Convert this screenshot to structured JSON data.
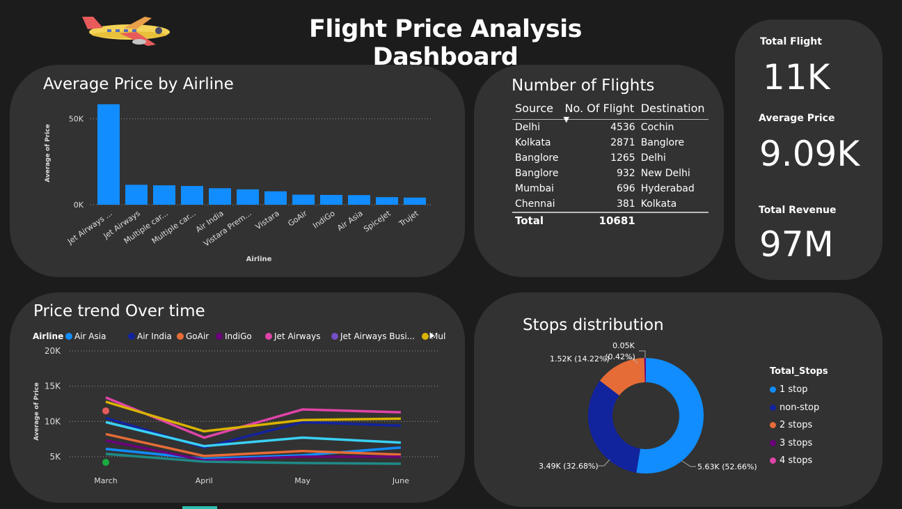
{
  "dashboard": {
    "title": "Flight Price Analysis Dashboard",
    "logo_icon": "airplane-icon"
  },
  "avg_price_card": {
    "title": "Average Price by Airline",
    "ylabel": "Average of Price",
    "xlabel": "Airline",
    "bar_color": "#118dff"
  },
  "flights_card": {
    "title": "Number of Flights",
    "columns": [
      "Source",
      "No. Of Flight",
      "Destination"
    ],
    "sort_indicator": "sort-desc-icon",
    "rows": [
      {
        "source": "Delhi",
        "count": "4536",
        "destination": "Cochin"
      },
      {
        "source": "Kolkata",
        "count": "2871",
        "destination": "Banglore"
      },
      {
        "source": "Banglore",
        "count": "1265",
        "destination": "Delhi"
      },
      {
        "source": "Banglore",
        "count": "932",
        "destination": "New Delhi"
      },
      {
        "source": "Mumbai",
        "count": "696",
        "destination": "Hyderabad"
      },
      {
        "source": "Chennai",
        "count": "381",
        "destination": "Kolkata"
      }
    ],
    "total_label": "Total",
    "total_value": "10681"
  },
  "kpis": {
    "total_flight_label": "Total Flight",
    "total_flight_value": "11K",
    "avg_price_label": "Average Price",
    "avg_price_value": "9.09K",
    "total_revenue_label": "Total Revenue",
    "total_revenue_value": "97M"
  },
  "trend_card": {
    "title": "Price trend Over time",
    "legend_title": "Airline",
    "legend_more_icon": "play-right-icon"
  },
  "stops_card": {
    "title": "Stops distribution",
    "legend_title": "Total_Stops"
  },
  "chart_data": [
    {
      "type": "bar",
      "title": "Average Price by Airline",
      "xlabel": "Airline",
      "ylabel": "Average of Price",
      "categories": [
        "Jet Airways ...",
        "Jet Airways",
        "Multiple car...",
        "Multiple car...",
        "Air India",
        "Vistara Prem...",
        "Vistara",
        "GoAir",
        "IndiGo",
        "Air Asia",
        "SpiceJet",
        "Trujet"
      ],
      "values": [
        58500,
        11600,
        11300,
        10900,
        9600,
        8950,
        7800,
        5850,
        5700,
        5600,
        4400,
        4150
      ],
      "yticks": [
        "0K",
        "50K"
      ],
      "ytick_values": [
        0,
        50000
      ],
      "ylim": [
        0,
        60000
      ],
      "grid": true
    },
    {
      "type": "line",
      "title": "Price trend Over time",
      "ylabel": "Average of Price",
      "categories": [
        "March",
        "April",
        "May",
        "June"
      ],
      "yticks": [
        "5K",
        "10K",
        "15K",
        "20K"
      ],
      "ytick_values": [
        5000,
        10000,
        15000,
        20000
      ],
      "ylim": [
        4000,
        20000
      ],
      "legend": [
        "Air Asia",
        "Air India",
        "GoAir",
        "IndiGo",
        "Jet Airways",
        "Jet Airways Busi...",
        "Multiple carri..."
      ],
      "series": [
        {
          "name": "Air Asia",
          "color": "#118dff",
          "values": [
            6100,
            4700,
            5200,
            6300
          ]
        },
        {
          "name": "Air India",
          "color": "#12239e",
          "values": [
            10500,
            6300,
            9900,
            9400
          ]
        },
        {
          "name": "GoAir",
          "color": "#e66c37",
          "values": [
            8200,
            5100,
            5800,
            5300
          ]
        },
        {
          "name": "IndiGo",
          "color": "#6b007b",
          "values": [
            7300,
            4500,
            5000,
            5000
          ]
        },
        {
          "name": "Jet Airways",
          "color": "#e044a7",
          "values": [
            13400,
            7700,
            11700,
            11300
          ]
        },
        {
          "name": "Multiple carri...",
          "color": "#d9b300",
          "values": [
            12800,
            8600,
            10200,
            10400
          ]
        },
        {
          "name": "",
          "color": "#3ad1f5",
          "values": [
            9900,
            6500,
            7700,
            7000
          ]
        },
        {
          "name": "",
          "color": "#1f8a87",
          "values": [
            5400,
            4300,
            4100,
            4000
          ]
        }
      ],
      "markers": [
        {
          "color": "#e35b5b",
          "x": "March",
          "y": 11500
        },
        {
          "color": "#1aab40",
          "x": "March",
          "y": 4200
        }
      ],
      "grid": true
    },
    {
      "type": "pie",
      "title": "Stops distribution",
      "legend_title": "Total_Stops",
      "slices": [
        {
          "label": "1 stop",
          "value": 52.66,
          "display": "5.63K (52.66%)",
          "color": "#118dff"
        },
        {
          "label": "non-stop",
          "value": 32.68,
          "display": "3.49K (32.68%)",
          "color": "#12239e"
        },
        {
          "label": "2 stops",
          "value": 14.22,
          "display": "1.52K (14.22%)",
          "color": "#e66c37"
        },
        {
          "label": "3 stops",
          "value": 0.42,
          "display": "0.05K (0.42%)",
          "color": "#6b007b"
        },
        {
          "label": "4 stops",
          "value": 0.02,
          "display": "",
          "color": "#e044a7"
        }
      ],
      "top_label_line1": "0.05K",
      "top_label_line2": "(0.42%)"
    }
  ]
}
